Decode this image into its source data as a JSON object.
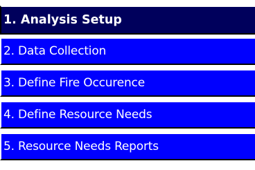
{
  "menu": {
    "items": [
      {
        "label": "1. Analysis Setup",
        "active": true
      },
      {
        "label": "2. Data Collection",
        "active": false
      },
      {
        "label": "3. Define Fire Occurence",
        "active": false
      },
      {
        "label": "4. Define Resource Needs",
        "active": false
      },
      {
        "label": "5. Resource Needs Reports",
        "active": false
      }
    ]
  },
  "colors": {
    "active_bg": "#00005c",
    "item_bg": "#0000ff",
    "text": "#ffffff"
  }
}
